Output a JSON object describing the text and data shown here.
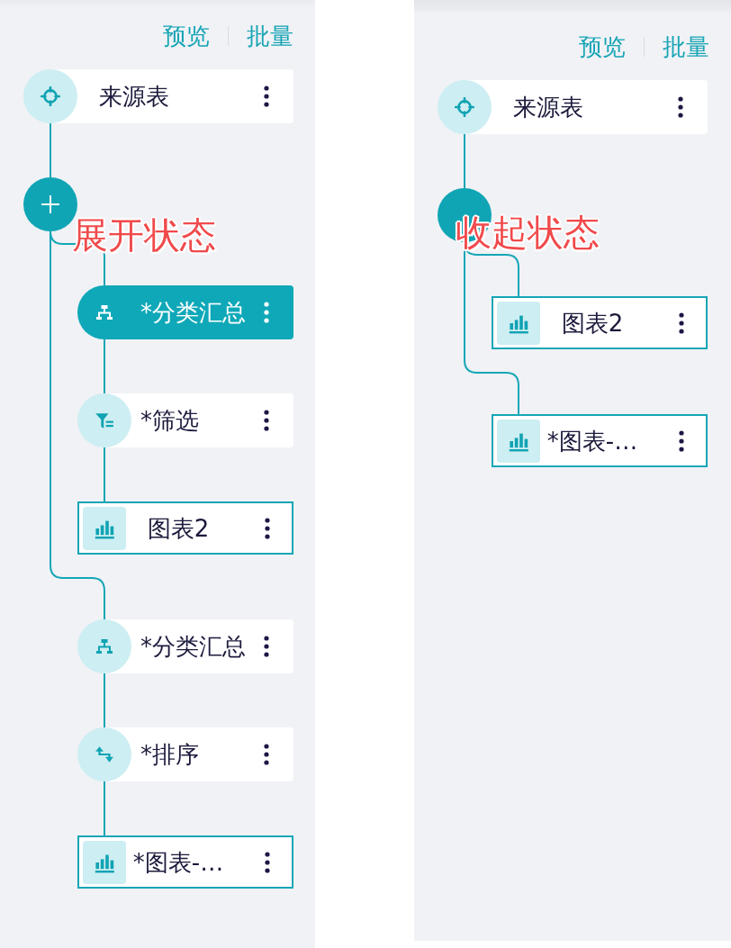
{
  "panels": [
    {
      "expanded": true,
      "actions": [
        {
          "label": "预览"
        },
        {
          "label": "批量"
        }
      ],
      "source": {
        "label": "来源表",
        "selected": false
      },
      "annotation": "展开状态",
      "branches": [
        {
          "nodes": [
            {
              "kind": "summary",
              "label": "*分类汇总",
              "selected": true
            },
            {
              "kind": "filter",
              "label": "*筛选",
              "selected": false
            },
            {
              "kind": "chart",
              "label": "图表2",
              "selected": false
            }
          ]
        },
        {
          "nodes": [
            {
              "kind": "summary",
              "label": "*分类汇总",
              "selected": false
            },
            {
              "kind": "sort",
              "label": "*排序",
              "selected": false
            },
            {
              "kind": "chart",
              "label": "*图表-…",
              "selected": false
            }
          ]
        }
      ]
    },
    {
      "expanded": false,
      "actions": [
        {
          "label": "预览"
        },
        {
          "label": "批量"
        }
      ],
      "source": {
        "label": "来源表",
        "selected": false
      },
      "annotation": "收起状态",
      "branches": [
        {
          "nodes": [
            {
              "kind": "chart",
              "label": "图表2",
              "selected": false
            }
          ]
        },
        {
          "nodes": [
            {
              "kind": "chart",
              "label": "*图表-…",
              "selected": false
            }
          ]
        }
      ]
    }
  ]
}
